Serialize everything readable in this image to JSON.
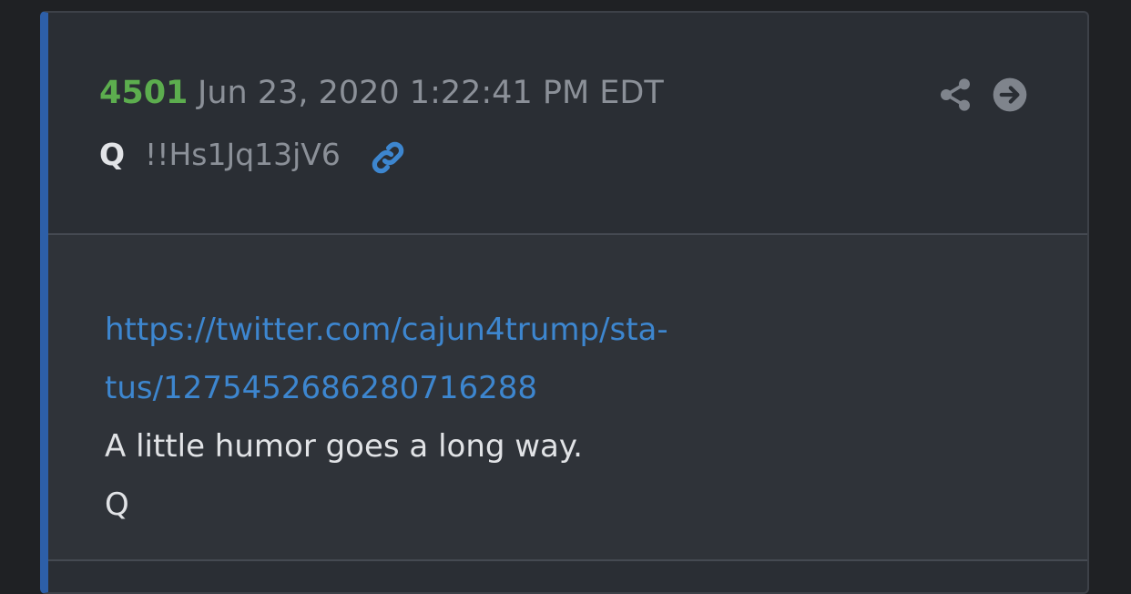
{
  "post": {
    "number": "4501",
    "date": "Jun 23, 2020 1:22:41 PM EDT",
    "author": "Q",
    "tripcode": "!!Hs1Jq13jV6",
    "link_line1": "https://twitter.com/cajun4trump/sta-",
    "link_line2": "tus/1275452686280716288",
    "text_line1": "A little humor goes a long way.",
    "text_line2": "Q"
  },
  "icons": {
    "link": "link-icon",
    "share": "share-icon",
    "navigate": "arrow-right-circle-icon"
  },
  "colors": {
    "post_number": "#5cad4e",
    "link": "#3d86cf",
    "accent_border": "#2d5fa8"
  }
}
